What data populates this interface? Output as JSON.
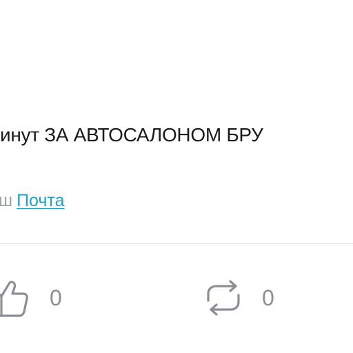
{
  "post": {
    "headline": "инут ЗА АВТОСАЛОНОМ БРУ",
    "meta_prefix": "ш",
    "source_link": "Почта"
  },
  "actions": {
    "like": {
      "icon": "thumbs-up-icon",
      "count": "0"
    },
    "repost": {
      "icon": "repost-icon",
      "count": "0"
    }
  },
  "colors": {
    "text": "#1a1a1a",
    "muted": "#9aa0a6",
    "link": "#1ea0c9",
    "icon": "#8a8f96",
    "divider": "#e6e6e6"
  }
}
